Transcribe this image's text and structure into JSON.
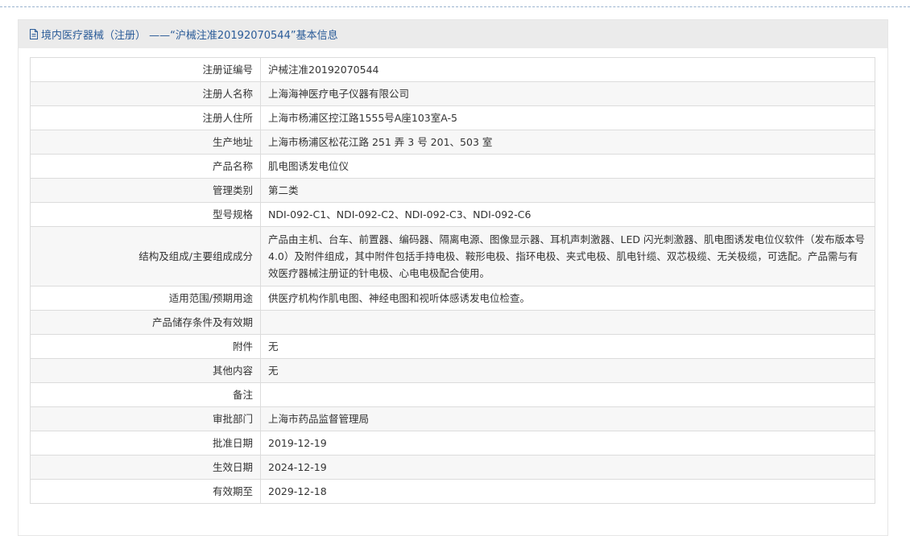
{
  "header": {
    "title": "境内医疗器械（注册） ——“沪械注准20192070544”基本信息"
  },
  "rows": [
    {
      "label": "注册证编号",
      "value": "沪械注准20192070544"
    },
    {
      "label": "注册人名称",
      "value": "上海海神医疗电子仪器有限公司"
    },
    {
      "label": "注册人住所",
      "value": "上海市杨浦区控江路1555号A座103室A-5"
    },
    {
      "label": "生产地址",
      "value": "上海市杨浦区松花江路 251 弄 3 号 201、503 室"
    },
    {
      "label": "产品名称",
      "value": "肌电图诱发电位仪"
    },
    {
      "label": "管理类别",
      "value": "第二类"
    },
    {
      "label": "型号规格",
      "value": "NDI-092-C1、NDI-092-C2、NDI-092-C3、NDI-092-C6"
    },
    {
      "label": "结构及组成/主要组成成分",
      "value": "产品由主机、台车、前置器、编码器、隔离电源、图像显示器、耳机声刺激器、LED 闪光刺激器、肌电图诱发电位仪软件（发布版本号 4.0）及附件组成，其中附件包括手持电极、鞍形电极、指环电极、夹式电极、肌电针缆、双芯极缆、无关极缆，可选配。产品需与有效医疗器械注册证的针电极、心电电极配合使用。"
    },
    {
      "label": "适用范围/预期用途",
      "value": "供医疗机构作肌电图、神经电图和视听体感诱发电位检查。"
    },
    {
      "label": "产品储存条件及有效期",
      "value": ""
    },
    {
      "label": "附件",
      "value": "无"
    },
    {
      "label": "其他内容",
      "value": "无"
    },
    {
      "label": "备注",
      "value": ""
    },
    {
      "label": "审批部门",
      "value": "上海市药品监督管理局"
    },
    {
      "label": "批准日期",
      "value": "2019-12-19"
    },
    {
      "label": "生效日期",
      "value": "2024-12-19"
    },
    {
      "label": "有效期至",
      "value": "2029-12-18"
    }
  ]
}
